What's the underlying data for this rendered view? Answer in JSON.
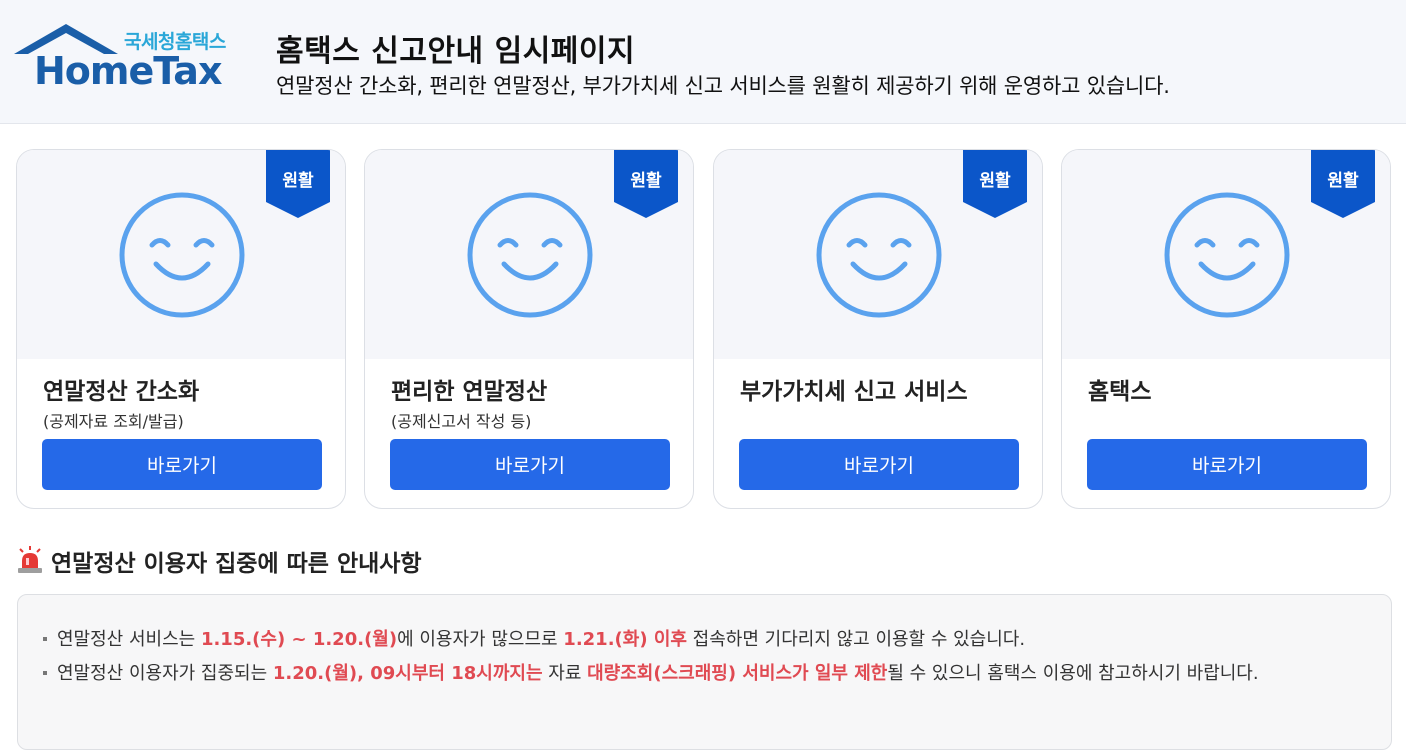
{
  "header": {
    "logo_korean": "국세청홈택스",
    "logo_main": "HomeTax",
    "title": "홈택스 신고안내 임시페이지",
    "subtitle": "연말정산 간소화, 편리한 연말정산, 부가가치세 신고 서비스를 원활히 제공하기 위해 운영하고 있습니다."
  },
  "cards": [
    {
      "badge": "원활",
      "title": "연말정산 간소화",
      "desc": "(공제자료 조회/발급)",
      "button": "바로가기"
    },
    {
      "badge": "원활",
      "title": "편리한 연말정산",
      "desc": "(공제신고서 작성 등)",
      "button": "바로가기"
    },
    {
      "badge": "원활",
      "title": "부가가치세 신고 서비스",
      "desc": "",
      "button": "바로가기"
    },
    {
      "badge": "원활",
      "title": "홈택스",
      "desc": "",
      "button": "바로가기"
    }
  ],
  "notice": {
    "title": "연말정산 이용자 집중에 따른 안내사항",
    "items": [
      {
        "p1": "연말정산 서비스는 ",
        "h1": "1.15.(수) ~ 1.20.(월)",
        "p2": "에 이용자가 많으므로 ",
        "h2": "1.21.(화) 이후",
        "p3": " 접속하면 기다리지 않고 이용할 수 있습니다."
      },
      {
        "p1": "연말정산 이용자가 집중되는 ",
        "h1": "1.20.(월), 09시부터 18시까지는",
        "p2": " 자료 ",
        "h2": "대량조회(스크래핑) 서비스가 일부 제한",
        "p3": "될 수 있으니 홈택스 이용에 참고하시기 바랍니다."
      }
    ]
  },
  "colors": {
    "primary_button": "#2569e8",
    "badge": "#0b56c9",
    "smiley": "#5aa2ee",
    "highlight": "#e04a52",
    "logo_blue": "#1a5ea8",
    "logo_cyan": "#2aa7d8"
  }
}
